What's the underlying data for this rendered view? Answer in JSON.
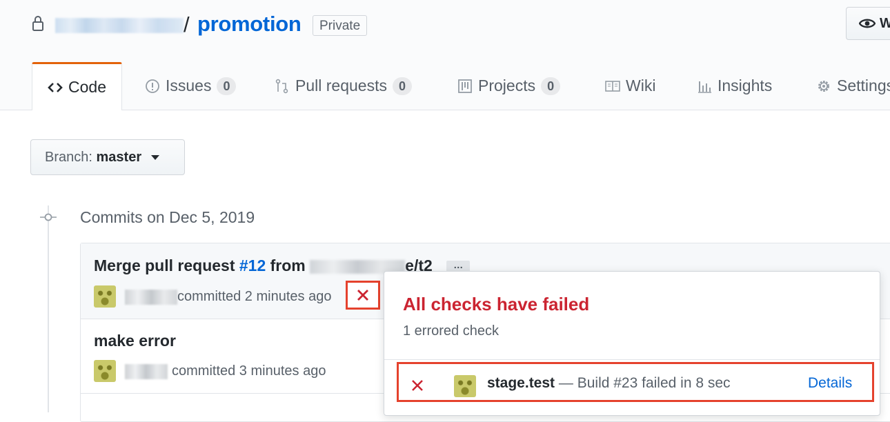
{
  "repo": {
    "name": "promotion",
    "slash": "/",
    "visibility": "Private",
    "watch_label": "Watch"
  },
  "tabs": [
    {
      "label": "Code",
      "count": null,
      "selected": true,
      "icon": "code-icon"
    },
    {
      "label": "Issues",
      "count": "0",
      "icon": "issue-icon"
    },
    {
      "label": "Pull requests",
      "count": "0",
      "icon": "pull-request-icon"
    },
    {
      "label": "Projects",
      "count": "0",
      "icon": "project-icon"
    },
    {
      "label": "Wiki",
      "count": null,
      "icon": "book-icon"
    },
    {
      "label": "Insights",
      "count": null,
      "icon": "graph-icon"
    },
    {
      "label": "Settings",
      "count": null,
      "icon": "gear-icon"
    }
  ],
  "branch": {
    "prefix": "Branch:",
    "name": "master"
  },
  "commits": {
    "heading": "Commits on Dec 5, 2019",
    "items": [
      {
        "title_prefix": "Merge pull request",
        "pr_link": "#12",
        "title_mid": "from",
        "title_suffix": "e/t2",
        "meta": "committed 2 minutes ago",
        "status": "failure"
      },
      {
        "title": "make error",
        "meta": "committed 3 minutes ago"
      }
    ]
  },
  "checks_popover": {
    "title": "All checks have failed",
    "subtitle": "1 errored check",
    "check": {
      "context": "stage.test",
      "description": "— Build #23 failed in 8 sec",
      "details_label": "Details"
    }
  },
  "colors": {
    "link": "#0366d6",
    "failure": "#cb2431",
    "highlight_box": "#e5422d",
    "tab_accent": "#e36209"
  }
}
